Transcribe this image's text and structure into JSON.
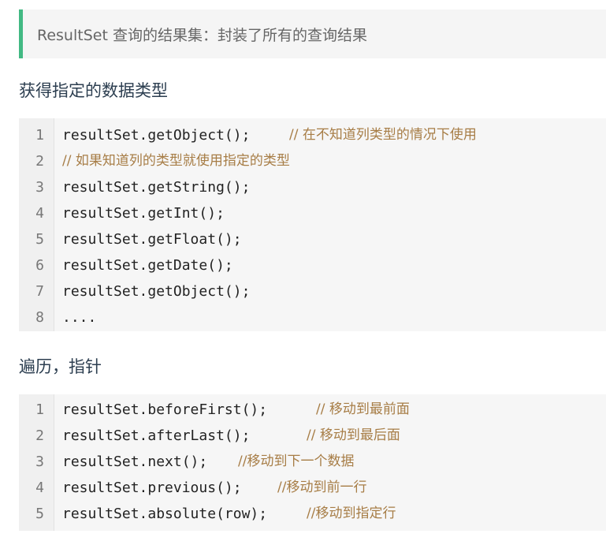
{
  "quote": {
    "text": "ResultSet 查询的结果集：封装了所有的查询结果"
  },
  "section1": {
    "heading": "获得指定的数据类型",
    "lines": [
      {
        "no": "1",
        "code": "resultSet.getObject();",
        "comment": "// 在不知道列类型的情况下使用"
      },
      {
        "no": "2",
        "code": "",
        "comment": "// 如果知道列的类型就使用指定的类型"
      },
      {
        "no": "3",
        "code": "resultSet.getString();",
        "comment": ""
      },
      {
        "no": "4",
        "code": "resultSet.getInt();",
        "comment": ""
      },
      {
        "no": "5",
        "code": "resultSet.getFloat();",
        "comment": ""
      },
      {
        "no": "6",
        "code": "resultSet.getDate();",
        "comment": ""
      },
      {
        "no": "7",
        "code": "resultSet.getObject();",
        "comment": ""
      },
      {
        "no": "8",
        "code": "....",
        "comment": ""
      }
    ]
  },
  "section2": {
    "heading": "遍历，指针",
    "lines": [
      {
        "no": "1",
        "code": "resultSet.beforeFirst();",
        "comment": "// 移动到最前面"
      },
      {
        "no": "2",
        "code": "resultSet.afterLast();",
        "comment": "// 移动到最后面"
      },
      {
        "no": "3",
        "code": "resultSet.next();",
        "comment": "//移动到下一个数据"
      },
      {
        "no": "4",
        "code": "resultSet.previous();",
        "comment": "//移动到前一行"
      },
      {
        "no": "5",
        "code": "resultSet.absolute(row);",
        "comment": "//移动到指定行"
      }
    ]
  },
  "colors": {
    "accent": "#42b983",
    "comment": "#a77d46",
    "code_background": "#f6f6f6"
  }
}
